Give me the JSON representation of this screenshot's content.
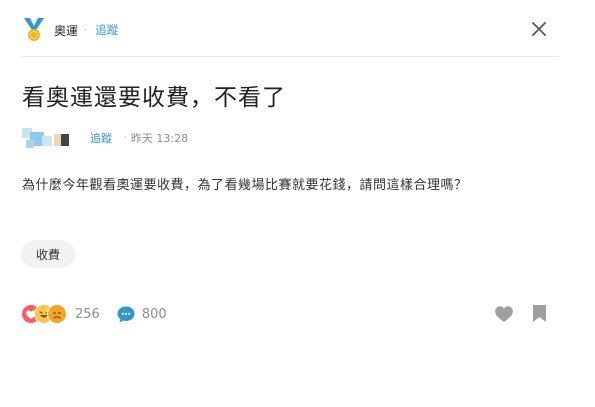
{
  "board": {
    "name": "奧運",
    "separator": "·",
    "follow_label": "追蹤",
    "icon": "olympic-medal-icon"
  },
  "post": {
    "title": "看奧運還要收費，不看了",
    "author": {
      "avatar": "blurred-avatar",
      "follow_label": "追蹤",
      "separator": "·",
      "time": "昨天 13:28"
    },
    "content": "為什麼今年觀看奧運要收費，為了看幾場比賽就要花錢，請問這樣合理嗎？",
    "tags": [
      "收費"
    ]
  },
  "footer": {
    "reaction_icons": [
      "heart-emoji-icon",
      "haha-emoji-icon",
      "sad-emoji-icon"
    ],
    "reaction_count": "256",
    "comment_icon": "comment-bubble-icon",
    "comment_count": "800",
    "like_icon": "heart-icon",
    "bookmark_icon": "bookmark-icon"
  },
  "colors": {
    "link": "#3397cf",
    "muted": "#8c8c8c",
    "icon_gray": "#9e9e9e",
    "tag_bg": "#f2f2f2",
    "comment_blue": "#3397cf"
  }
}
